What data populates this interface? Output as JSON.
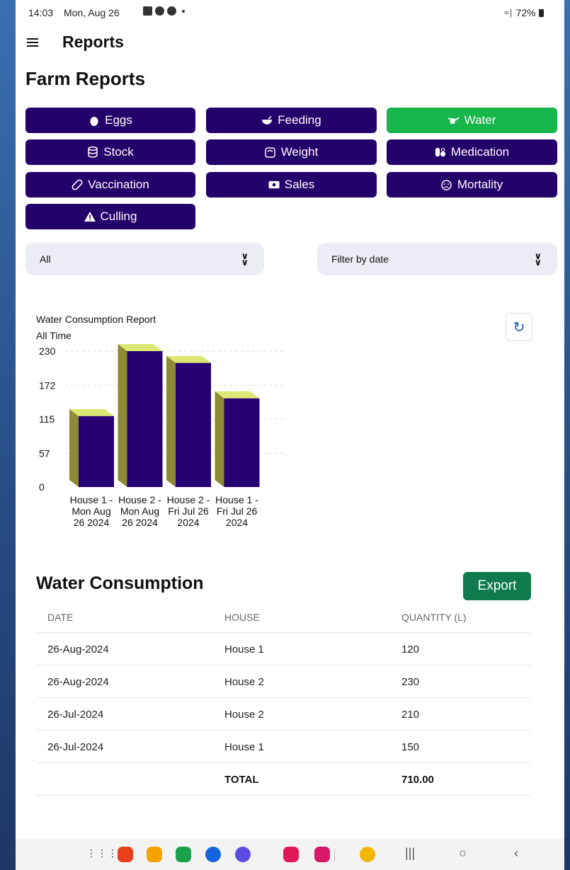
{
  "status_bar": {
    "time": "14:03",
    "date": "Mon, Aug 26",
    "battery": "72%"
  },
  "app_bar": {
    "title": "Reports"
  },
  "page_title": "Farm Reports",
  "report_buttons": [
    {
      "label": "Eggs",
      "icon": "egg-icon",
      "active": false
    },
    {
      "label": "Feeding",
      "icon": "bowl-icon",
      "active": false
    },
    {
      "label": "Water",
      "icon": "watering-can-icon",
      "active": true
    },
    {
      "label": "Stock",
      "icon": "database-icon",
      "active": false
    },
    {
      "label": "Weight",
      "icon": "scale-icon",
      "active": false
    },
    {
      "label": "Medication",
      "icon": "pills-icon",
      "active": false
    },
    {
      "label": "Vaccination",
      "icon": "bandage-icon",
      "active": false
    },
    {
      "label": "Sales",
      "icon": "money-icon",
      "active": false
    },
    {
      "label": "Mortality",
      "icon": "sad-face-icon",
      "active": false
    },
    {
      "label": "Culling",
      "icon": "warning-icon",
      "active": false
    }
  ],
  "filters": {
    "house": "All",
    "date": "Filter by date"
  },
  "chart_data": {
    "type": "bar",
    "title": "Water Consumption Report",
    "subtitle": "All Time",
    "categories": [
      [
        "House 1 -",
        "Mon Aug",
        "26 2024"
      ],
      [
        "House 2 -",
        "Mon Aug",
        "26 2024"
      ],
      [
        "House 2 -",
        "Fri Jul 26",
        "2024"
      ],
      [
        "House 1 -",
        "Fri Jul 26",
        "2024"
      ]
    ],
    "values": [
      120,
      230,
      210,
      150
    ],
    "yticks": [
      0,
      57,
      115,
      172,
      230
    ],
    "ylim": [
      0,
      230
    ],
    "grid": true,
    "style": "3d",
    "colors": {
      "front": "#260072",
      "top": "#dce874",
      "side": "#8c8a32"
    }
  },
  "table": {
    "title": "Water Consumption",
    "export_label": "Export",
    "headers": [
      "DATE",
      "HOUSE",
      "QUANTITY (L)"
    ],
    "rows": [
      [
        "26-Aug-2024",
        "House 1",
        "120"
      ],
      [
        "26-Aug-2024",
        "House 2",
        "230"
      ],
      [
        "26-Jul-2024",
        "House 2",
        "210"
      ],
      [
        "26-Jul-2024",
        "House 1",
        "150"
      ]
    ],
    "total_label": "TOTAL",
    "total_value": "710.00"
  },
  "colors": {
    "primary": "#24006a",
    "active": "#16b64a",
    "export": "#0e7a4e",
    "refresh": "#1a56b4"
  }
}
